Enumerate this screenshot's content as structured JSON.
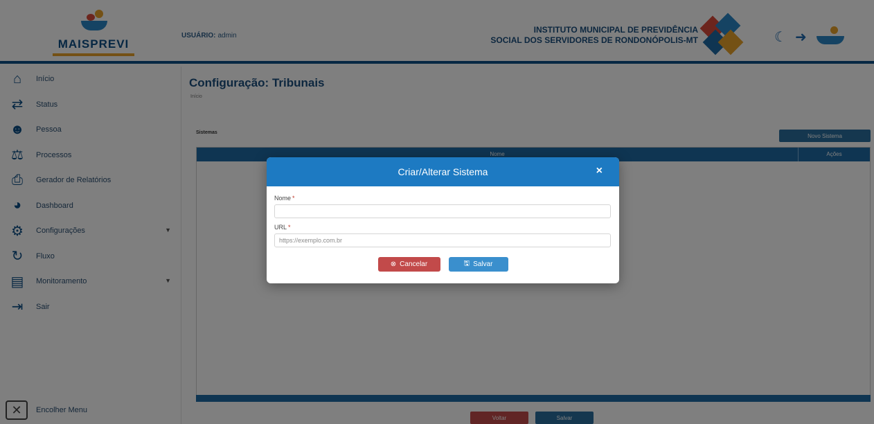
{
  "header": {
    "brand": "MAISPREVI",
    "user_label": "USUÁRIO:",
    "user_name": "admin",
    "institute_line1": "INSTITUTO MUNICIPAL DE PREVIDÊNCIA",
    "institute_line2": "SOCIAL DOS SERVIDORES DE RONDONÓPOLIS-MT",
    "icons": [
      "moon-icon",
      "logout-icon",
      "hands-logo-icon"
    ]
  },
  "sidebar": {
    "items": [
      {
        "label": "Início",
        "icon": "home-icon",
        "has_children": false
      },
      {
        "label": "Status",
        "icon": "exchange-icon",
        "has_children": false
      },
      {
        "label": "Pessoa",
        "icon": "users-icon",
        "has_children": false
      },
      {
        "label": "Processos",
        "icon": "balance-icon",
        "has_children": false
      },
      {
        "label": "Gerador de Relatórios",
        "icon": "printer-icon",
        "has_children": false
      },
      {
        "label": "Dashboard",
        "icon": "chart-pie-icon",
        "has_children": false
      },
      {
        "label": "Configurações",
        "icon": "gear-icon",
        "has_children": true
      },
      {
        "label": "Fluxo",
        "icon": "sync-icon",
        "has_children": false
      },
      {
        "label": "Monitoramento",
        "icon": "monitor-icon",
        "has_children": true
      },
      {
        "label": "Sair",
        "icon": "exit-icon",
        "has_children": false
      }
    ],
    "collapse_label": "Encolher Menu"
  },
  "main": {
    "title": "Configuração: Tribunais",
    "breadcrumb": "Início",
    "section_label": "Sistemas",
    "new_button": "Novo Sistema",
    "grid_columns": [
      "Nome",
      "Ações"
    ],
    "bottom_buttons": [
      {
        "label": "Voltar",
        "color": "#c24a4a"
      },
      {
        "label": "Salvar",
        "color": "#2b6f9f"
      }
    ]
  },
  "modal": {
    "title": "Criar/Alterar Sistema",
    "close_glyph": "×",
    "fields": [
      {
        "label": "Nome",
        "required_mark": "*",
        "value": "",
        "placeholder": ""
      },
      {
        "label": "URL",
        "required_mark": "*",
        "value": "",
        "placeholder": "https://exemplo.com.br"
      }
    ],
    "cancel_label": "Cancelar",
    "save_label": "Salvar"
  },
  "colors": {
    "primary": "#1d7ac2",
    "navy": "#0d4e86",
    "danger": "#c24a4a",
    "accent": "#e8a22b"
  }
}
